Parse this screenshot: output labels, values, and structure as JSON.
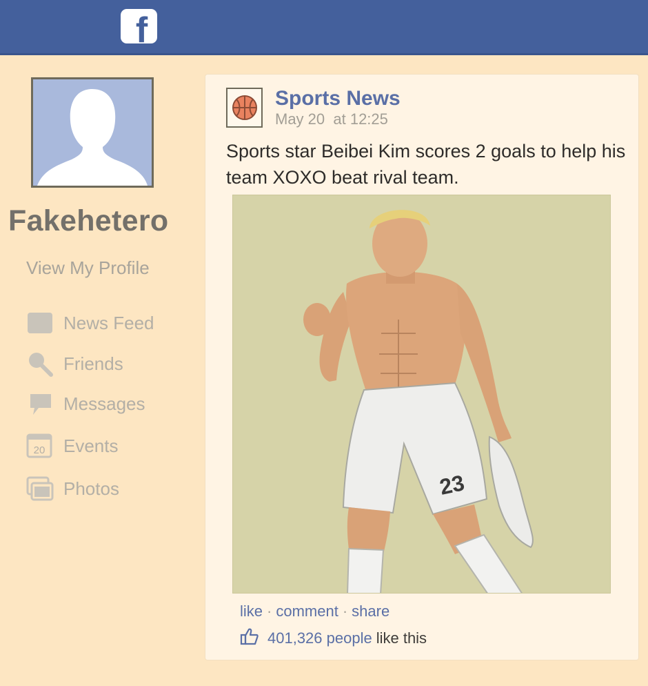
{
  "header": {
    "logo_icon": "facebook-logo-icon",
    "logo_letter": "f",
    "bar_color": "#44609c"
  },
  "sidebar": {
    "profile_name": "Fakehetero",
    "view_profile": "View My Profile",
    "items": [
      {
        "label": "News Feed",
        "icon": "news-feed-icon"
      },
      {
        "label": "Friends",
        "icon": "search-icon"
      },
      {
        "label": "Messages",
        "icon": "speech-bubble-icon"
      },
      {
        "label": "Events",
        "icon": "calendar-icon",
        "icon_text": "20"
      },
      {
        "label": "Photos",
        "icon": "photos-icon"
      }
    ]
  },
  "post": {
    "page_name": "Sports News",
    "page_icon": "basketball-icon",
    "timestamp": "May 20  at 12:25",
    "text": "Sports star Beibei Kim scores 2 goals to help his team XOXO beat rival team.",
    "photo_jersey_number": "23",
    "actions": {
      "like": "like",
      "comment": "comment",
      "share": "share",
      "separator": "·"
    },
    "likes_count": "401,326 people",
    "likes_tail": "like this",
    "link_color": "#5a6fa6"
  }
}
